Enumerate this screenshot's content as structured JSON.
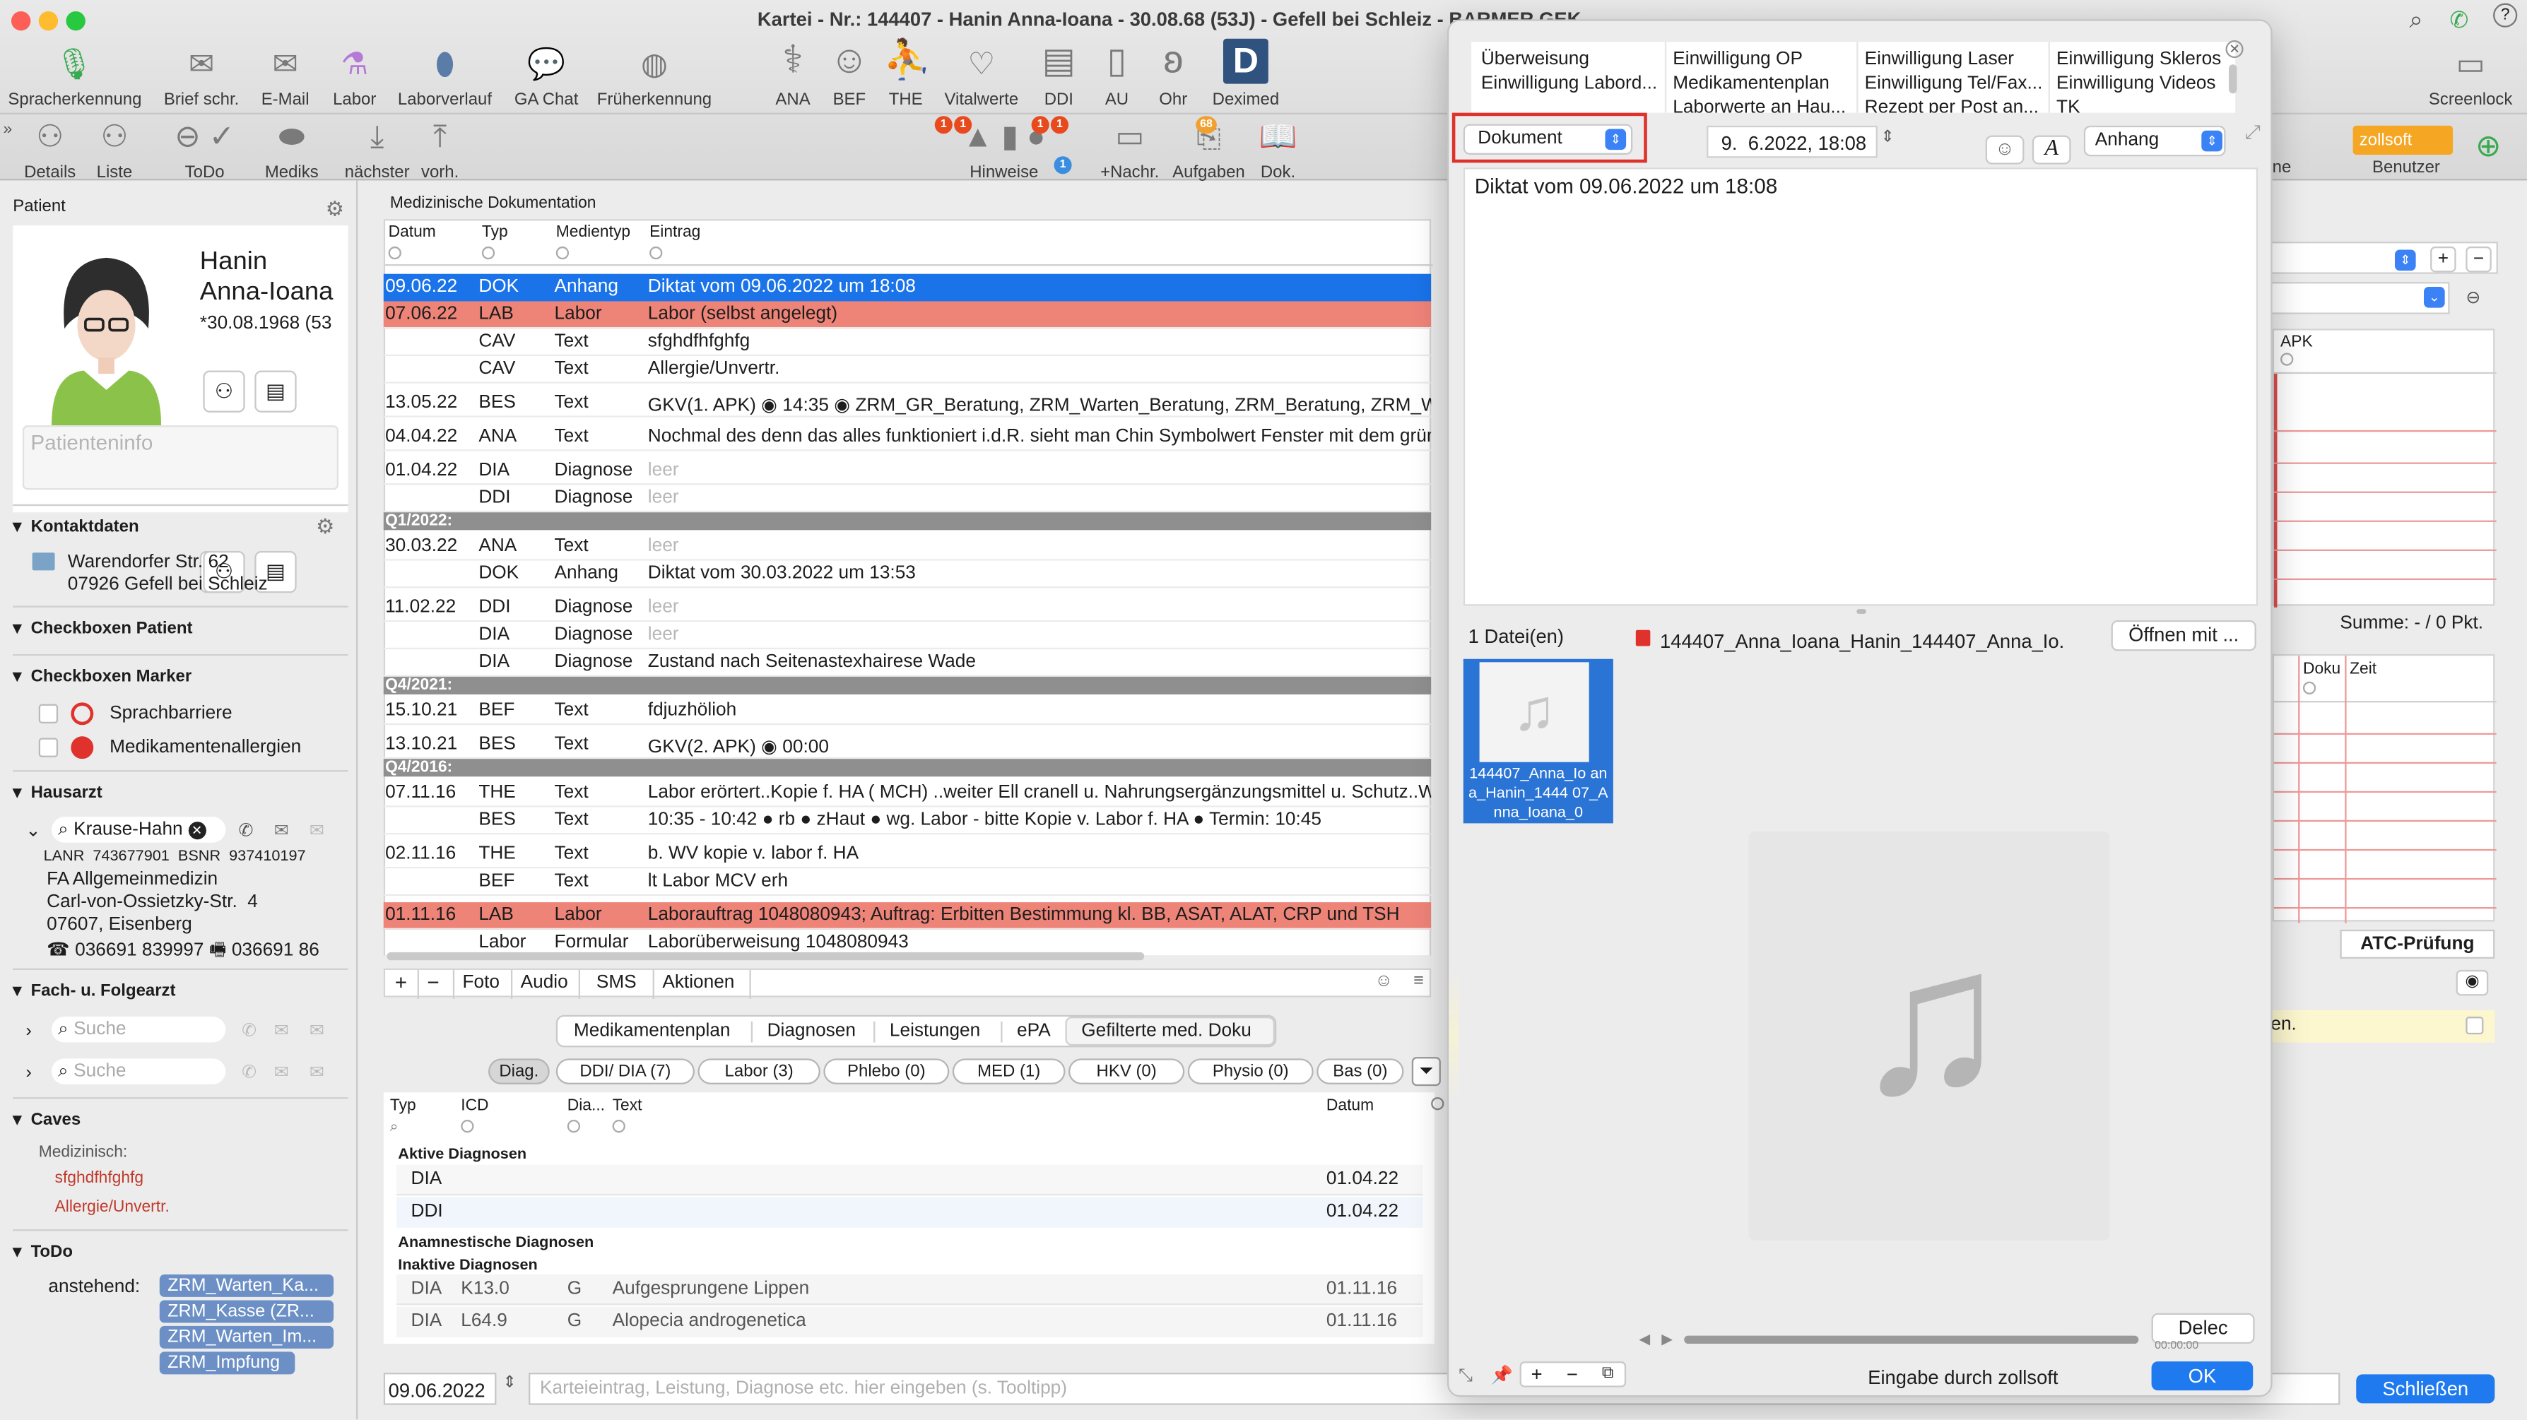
{
  "window": {
    "title": "Kartei - Nr.: 144407 - Hanin Anna-Ioana - 30.08.68 (53J) - Gefell bei Schleiz - BARMER GEK"
  },
  "toolbar_top": [
    {
      "label": "Spracherkennung",
      "icon": "microphone-icon"
    },
    {
      "label": "Brief schr.",
      "icon": "letter-icon"
    },
    {
      "label": "E-Mail",
      "icon": "mail-icon"
    },
    {
      "label": "Labor",
      "icon": "flask-icon"
    },
    {
      "label": "Laborverlauf",
      "icon": "drop-icon"
    },
    {
      "label": "GA Chat",
      "icon": "chat-icon"
    },
    {
      "label": "Früherkennung",
      "icon": "globe-icon"
    },
    {
      "label": "ANA",
      "icon": "stethoscope-icon"
    },
    {
      "label": "BEF",
      "icon": "doctor-icon"
    },
    {
      "label": "THE",
      "icon": "therapy-icon"
    },
    {
      "label": "Vitalwerte",
      "icon": "heart-icon"
    },
    {
      "label": "DDI",
      "icon": "clipboard-icon"
    },
    {
      "label": "AU",
      "icon": "au-form-icon"
    },
    {
      "label": "Ohr",
      "icon": "ear-icon"
    },
    {
      "label": "Deximed",
      "icon": "deximed-icon"
    },
    {
      "label": "Screenlock",
      "icon": "monitor-icon"
    }
  ],
  "toolbar_bottom": [
    {
      "label": "Details",
      "icon": "person-icon"
    },
    {
      "label": "Liste",
      "icon": "person-add-icon"
    },
    {
      "label": "ToDo",
      "icon": "back-circle-icon"
    },
    {
      "label": "Mediks",
      "icon": "pill-icon"
    },
    {
      "label": "nächster",
      "icon": "arrow-down-icon"
    },
    {
      "label": "vorh.",
      "icon": "arrow-up-icon"
    },
    {
      "label": "Hinweise",
      "icon": "alert-icon"
    },
    {
      "label": "+Nachr.",
      "icon": "message-icon"
    },
    {
      "label": "Aufgaben",
      "icon": "tasks-icon"
    },
    {
      "label": "Dok.",
      "icon": "book-icon"
    },
    {
      "label": "Benutzer",
      "icon": "user-icon"
    }
  ],
  "badges": {
    "hinweise1": "1",
    "hinweise2": "1",
    "hinweise3": "1",
    "hinweise4": "1",
    "hinweise5": "1",
    "aufgaben": "68"
  },
  "zollsoft_label": "zollsoft",
  "patient": {
    "header": "Patient",
    "first_name": "Hanin",
    "last_name": "Anna-Ioana",
    "dob": "*30.08.1968 (53",
    "info_placeholder": "Patienteninfo"
  },
  "sections": {
    "kontakt": "Kontaktdaten",
    "street": "Warendorfer Str. 62",
    "city": "07926 Gefell bei Schleiz",
    "checkbox_patient": "Checkboxen Patient",
    "checkbox_marker": "Checkboxen Marker",
    "marker1": "Sprachbarriere",
    "marker2": "Medikamentenallergien",
    "hausarzt": "Hausarzt",
    "ha_name": "Krause-Hahn",
    "lanr": "LANR  743677901  BSNR  937410197",
    "ha_l1": "FA Allgemeinmedizin",
    "ha_l2": "Carl-von-Ossietzky-Str.  4",
    "ha_l3": "07607, Eisenberg",
    "ha_phone": "036691 839997",
    "ha_fax": "036691 86",
    "fach": "Fach- u. Folgearzt",
    "search1": "Suche",
    "search2": "Suche",
    "caves": "Caves",
    "medizinisch": "Medizinisch:",
    "cave1": "sfghdfhfghfg",
    "cave2": "Allergie/Unvertr.",
    "todo": "ToDo",
    "anstehend": "anstehend:",
    "todo_tags": [
      "ZRM_Warten_Ka...",
      "ZRM_Kasse (ZR...",
      "ZRM_Warten_Im...",
      "ZRM_Impfung"
    ]
  },
  "doku": {
    "title": "Medizinische Dokumentation",
    "cols": [
      "Datum",
      "Typ",
      "Medientyp",
      "Eintrag"
    ],
    "rows": [
      {
        "date": "09.06.22",
        "typ": "DOK",
        "med": "Anhang",
        "entry": "Diktat vom 09.06.2022 um 18:08",
        "style": "sel"
      },
      {
        "date": "07.06.22",
        "typ": "LAB",
        "med": "Labor",
        "entry": "Labor (selbst angelegt)",
        "style": "lab"
      },
      {
        "date": "",
        "typ": "CAV",
        "med": "Text",
        "entry": "sfghdfhfghfg",
        "style": ""
      },
      {
        "date": "",
        "typ": "CAV",
        "med": "Text",
        "entry": "Allergie/Unvertr.",
        "style": ""
      },
      {
        "date": "13.05.22",
        "typ": "BES",
        "med": "Text",
        "entry": "GKV(1. APK) ◉ 14:35 ◉ ZRM_GR_Beratung, ZRM_Warten_Beratung, ZRM_Beratung, ZRM_W",
        "style": "gap"
      },
      {
        "date": "04.04.22",
        "typ": "ANA",
        "med": "Text",
        "entry": "Nochmal des denn das alles funktioniert i.d.R. sieht man Chin Symbolwert Fenster mit dem grün",
        "style": "gap"
      },
      {
        "date": "01.04.22",
        "typ": "DIA",
        "med": "Diagnose",
        "entry": "leer",
        "style": "gap-leer"
      },
      {
        "date": "",
        "typ": "DDI",
        "med": "Diagnose",
        "entry": "leer",
        "style": "leer"
      },
      {
        "date": "Q1/2022:",
        "typ": "",
        "med": "",
        "entry": "",
        "style": "q"
      },
      {
        "date": "30.03.22",
        "typ": "ANA",
        "med": "Text",
        "entry": "leer",
        "style": "leer"
      },
      {
        "date": "",
        "typ": "DOK",
        "med": "Anhang",
        "entry": "Diktat vom 30.03.2022 um 13:53",
        "style": ""
      },
      {
        "date": "11.02.22",
        "typ": "DDI",
        "med": "Diagnose",
        "entry": "leer",
        "style": "gap-leer"
      },
      {
        "date": "",
        "typ": "DIA",
        "med": "Diagnose",
        "entry": "leer",
        "style": "leer"
      },
      {
        "date": "",
        "typ": "DIA",
        "med": "Diagnose",
        "entry": "Zustand nach Seitenastexhairese Wade",
        "style": ""
      },
      {
        "date": "Q4/2021:",
        "typ": "",
        "med": "",
        "entry": "",
        "style": "q"
      },
      {
        "date": "15.10.21",
        "typ": "BEF",
        "med": "Text",
        "entry": "fdjuzhölioh",
        "style": ""
      },
      {
        "date": "13.10.21",
        "typ": "BES",
        "med": "Text",
        "entry": "GKV(2. APK) ◉ 00:00",
        "style": "gap"
      },
      {
        "date": "Q4/2016:",
        "typ": "",
        "med": "",
        "entry": "",
        "style": "q"
      },
      {
        "date": "07.11.16",
        "typ": "THE",
        "med": "Text",
        "entry": "Labor erörtert..Kopie f. HA ( MCH) ..weiter Ell cranell u. Nahrungsergänzungsmittel u. Schutz..W",
        "style": ""
      },
      {
        "date": "",
        "typ": "BES",
        "med": "Text",
        "entry": "10:35 - 10:42 ● rb ● zHaut ● wg. Labor - bitte Kopie v. Labor f. HA ● Termin: 10:45",
        "style": ""
      },
      {
        "date": "02.11.16",
        "typ": "THE",
        "med": "Text",
        "entry": "b. WV kopie v. labor f. HA",
        "style": "gap"
      },
      {
        "date": "",
        "typ": "BEF",
        "med": "Text",
        "entry": "lt Labor MCV erh",
        "style": ""
      },
      {
        "date": "01.11.16",
        "typ": "LAB",
        "med": "Labor",
        "entry": "Laborauftrag 1048080943; Auftrag: Erbitten Bestimmung kl. BB, ASAT, ALAT, CRP und TSH",
        "style": "lab-gap"
      },
      {
        "date": "",
        "typ": "Labor",
        "med": "Formular",
        "entry": "Laborüberweisung 1048080943",
        "style": ""
      }
    ],
    "bottom_buttons": [
      "Foto",
      "Audio",
      "SMS",
      "Aktionen"
    ]
  },
  "lower": {
    "tabs": [
      "Medikamentenplan",
      "Diagnosen",
      "Leistungen",
      "ePA",
      "Gefilterte med. Doku"
    ],
    "filters": [
      "Diag.",
      "DDI/ DIA (7)",
      "Labor (3)",
      "Phlebo (0)",
      "MED (1)",
      "HKV (0)",
      "Physio (0)",
      "Bas (0)"
    ],
    "cols": [
      "Typ",
      "ICD",
      "Dia...",
      "Text",
      "Datum"
    ],
    "grp_aktiv": "Aktive Diagnosen",
    "aktiv": [
      {
        "typ": "DIA",
        "date": "01.04.22"
      },
      {
        "typ": "DDI",
        "date": "01.04.22"
      }
    ],
    "grp_anam": "Anamnestische Diagnosen",
    "grp_inaktiv": "Inaktive Diagnosen",
    "inaktiv": [
      {
        "typ": "DIA",
        "icd": "K13.0",
        "g": "G",
        "text": "Aufgesprungene Lippen",
        "date": "01.11.16"
      },
      {
        "typ": "DIA",
        "icd": "L64.9",
        "g": "G",
        "text": "Alopecia androgenetica",
        "date": "01.11.16"
      }
    ]
  },
  "entry_bar": {
    "date": "09.06.2022",
    "placeholder": "Karteieintrag, Leistung, Diagnose etc. hier eingeben (s. Tooltipp)",
    "close_btn": "Schließen"
  },
  "right": {
    "apk": "APK",
    "summe": "Summe: - / 0 Pkt.",
    "doku": "Doku",
    "zeit": "Zeit",
    "atc": "ATC-Prüfung",
    "en": "en.",
    "ne": "ne"
  },
  "popup": {
    "templates": [
      "Überweisung",
      "Einwilligung OP",
      "Einwilligung Laser",
      "Einwilligung Skleros",
      "Einwilligung Labord...",
      "Medikamentenplan",
      "Einwilligung Tel/Fax...",
      "Einwilligung Videos",
      "",
      "Laborwerte an Hau...",
      "Rezept per Post an...",
      "TK"
    ],
    "doc_type": "Dokument",
    "datetime": "9.  6.2022, 18:08",
    "attachment": "Anhang",
    "text": "Diktat vom 09.06.2022 um 18:08",
    "files_count": "1 Datei(en)",
    "file_name": "144407_Anna_Ioana_Hanin_144407_Anna_Io...",
    "open_with": "Öffnen mit ...",
    "thumb_caption": "144407_Anna_Io ana_Hanin_1444 07_Anna_Ioana_0",
    "delete_btn": "Delec",
    "footer_text": "Eingabe durch zollsoft",
    "ok": "OK"
  },
  "colors": {
    "selected": "#1a73e8",
    "lab": "#ee8378",
    "tag": "#6c90c6",
    "highlight": "#e0322d"
  }
}
